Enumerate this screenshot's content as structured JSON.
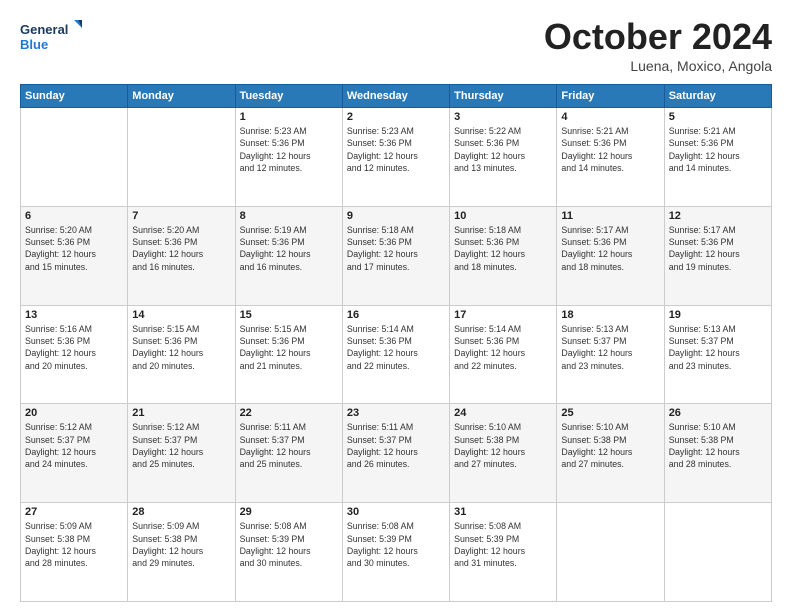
{
  "header": {
    "logo_line1": "General",
    "logo_line2": "Blue",
    "month": "October 2024",
    "location": "Luena, Moxico, Angola"
  },
  "weekdays": [
    "Sunday",
    "Monday",
    "Tuesday",
    "Wednesday",
    "Thursday",
    "Friday",
    "Saturday"
  ],
  "rows": [
    [
      {
        "day": "",
        "text": ""
      },
      {
        "day": "",
        "text": ""
      },
      {
        "day": "1",
        "text": "Sunrise: 5:23 AM\nSunset: 5:36 PM\nDaylight: 12 hours\nand 12 minutes."
      },
      {
        "day": "2",
        "text": "Sunrise: 5:23 AM\nSunset: 5:36 PM\nDaylight: 12 hours\nand 12 minutes."
      },
      {
        "day": "3",
        "text": "Sunrise: 5:22 AM\nSunset: 5:36 PM\nDaylight: 12 hours\nand 13 minutes."
      },
      {
        "day": "4",
        "text": "Sunrise: 5:21 AM\nSunset: 5:36 PM\nDaylight: 12 hours\nand 14 minutes."
      },
      {
        "day": "5",
        "text": "Sunrise: 5:21 AM\nSunset: 5:36 PM\nDaylight: 12 hours\nand 14 minutes."
      }
    ],
    [
      {
        "day": "6",
        "text": "Sunrise: 5:20 AM\nSunset: 5:36 PM\nDaylight: 12 hours\nand 15 minutes."
      },
      {
        "day": "7",
        "text": "Sunrise: 5:20 AM\nSunset: 5:36 PM\nDaylight: 12 hours\nand 16 minutes."
      },
      {
        "day": "8",
        "text": "Sunrise: 5:19 AM\nSunset: 5:36 PM\nDaylight: 12 hours\nand 16 minutes."
      },
      {
        "day": "9",
        "text": "Sunrise: 5:18 AM\nSunset: 5:36 PM\nDaylight: 12 hours\nand 17 minutes."
      },
      {
        "day": "10",
        "text": "Sunrise: 5:18 AM\nSunset: 5:36 PM\nDaylight: 12 hours\nand 18 minutes."
      },
      {
        "day": "11",
        "text": "Sunrise: 5:17 AM\nSunset: 5:36 PM\nDaylight: 12 hours\nand 18 minutes."
      },
      {
        "day": "12",
        "text": "Sunrise: 5:17 AM\nSunset: 5:36 PM\nDaylight: 12 hours\nand 19 minutes."
      }
    ],
    [
      {
        "day": "13",
        "text": "Sunrise: 5:16 AM\nSunset: 5:36 PM\nDaylight: 12 hours\nand 20 minutes."
      },
      {
        "day": "14",
        "text": "Sunrise: 5:15 AM\nSunset: 5:36 PM\nDaylight: 12 hours\nand 20 minutes."
      },
      {
        "day": "15",
        "text": "Sunrise: 5:15 AM\nSunset: 5:36 PM\nDaylight: 12 hours\nand 21 minutes."
      },
      {
        "day": "16",
        "text": "Sunrise: 5:14 AM\nSunset: 5:36 PM\nDaylight: 12 hours\nand 22 minutes."
      },
      {
        "day": "17",
        "text": "Sunrise: 5:14 AM\nSunset: 5:36 PM\nDaylight: 12 hours\nand 22 minutes."
      },
      {
        "day": "18",
        "text": "Sunrise: 5:13 AM\nSunset: 5:37 PM\nDaylight: 12 hours\nand 23 minutes."
      },
      {
        "day": "19",
        "text": "Sunrise: 5:13 AM\nSunset: 5:37 PM\nDaylight: 12 hours\nand 23 minutes."
      }
    ],
    [
      {
        "day": "20",
        "text": "Sunrise: 5:12 AM\nSunset: 5:37 PM\nDaylight: 12 hours\nand 24 minutes."
      },
      {
        "day": "21",
        "text": "Sunrise: 5:12 AM\nSunset: 5:37 PM\nDaylight: 12 hours\nand 25 minutes."
      },
      {
        "day": "22",
        "text": "Sunrise: 5:11 AM\nSunset: 5:37 PM\nDaylight: 12 hours\nand 25 minutes."
      },
      {
        "day": "23",
        "text": "Sunrise: 5:11 AM\nSunset: 5:37 PM\nDaylight: 12 hours\nand 26 minutes."
      },
      {
        "day": "24",
        "text": "Sunrise: 5:10 AM\nSunset: 5:38 PM\nDaylight: 12 hours\nand 27 minutes."
      },
      {
        "day": "25",
        "text": "Sunrise: 5:10 AM\nSunset: 5:38 PM\nDaylight: 12 hours\nand 27 minutes."
      },
      {
        "day": "26",
        "text": "Sunrise: 5:10 AM\nSunset: 5:38 PM\nDaylight: 12 hours\nand 28 minutes."
      }
    ],
    [
      {
        "day": "27",
        "text": "Sunrise: 5:09 AM\nSunset: 5:38 PM\nDaylight: 12 hours\nand 28 minutes."
      },
      {
        "day": "28",
        "text": "Sunrise: 5:09 AM\nSunset: 5:38 PM\nDaylight: 12 hours\nand 29 minutes."
      },
      {
        "day": "29",
        "text": "Sunrise: 5:08 AM\nSunset: 5:39 PM\nDaylight: 12 hours\nand 30 minutes."
      },
      {
        "day": "30",
        "text": "Sunrise: 5:08 AM\nSunset: 5:39 PM\nDaylight: 12 hours\nand 30 minutes."
      },
      {
        "day": "31",
        "text": "Sunrise: 5:08 AM\nSunset: 5:39 PM\nDaylight: 12 hours\nand 31 minutes."
      },
      {
        "day": "",
        "text": ""
      },
      {
        "day": "",
        "text": ""
      }
    ]
  ]
}
